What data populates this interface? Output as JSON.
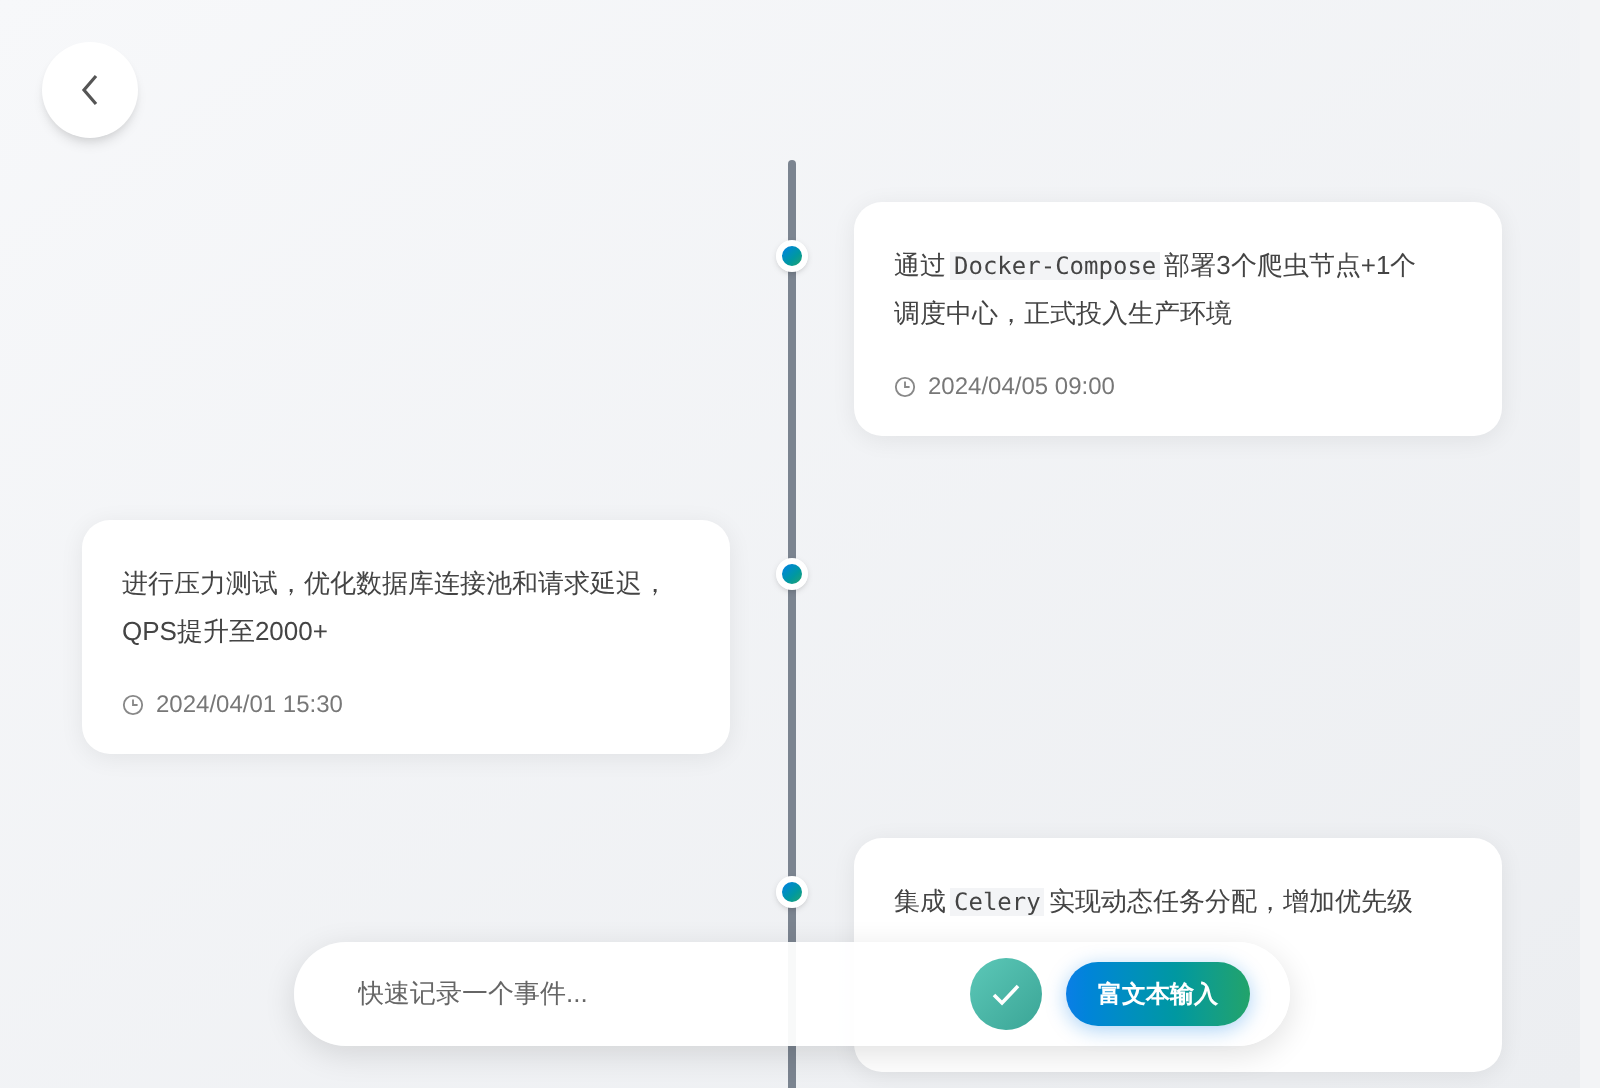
{
  "events": [
    {
      "kind": "right",
      "parts": [
        {
          "kind": "text",
          "text": "通过"
        },
        {
          "kind": "code",
          "text": "Docker-Compose"
        },
        {
          "kind": "text",
          "text": "部署3个爬虫节点+1个调度中心，正式投入生产环境"
        }
      ],
      "time": "2024/04/05 09:00"
    },
    {
      "kind": "left",
      "parts": [
        {
          "kind": "text",
          "text": "进行压力测试，优化数据库连接池和请求延迟，QPS提升至2000+"
        }
      ],
      "time": "2024/04/01 15:30"
    },
    {
      "kind": "right",
      "parts": [
        {
          "kind": "text",
          "text": "集成"
        },
        {
          "kind": "code",
          "text": "Celery"
        },
        {
          "kind": "text",
          "text": "实现动态任务分配，增加优先级"
        }
      ]
    }
  ],
  "quick_input": {
    "placeholder": "快速记录一个事件...",
    "rich_button": "富文本输入"
  }
}
